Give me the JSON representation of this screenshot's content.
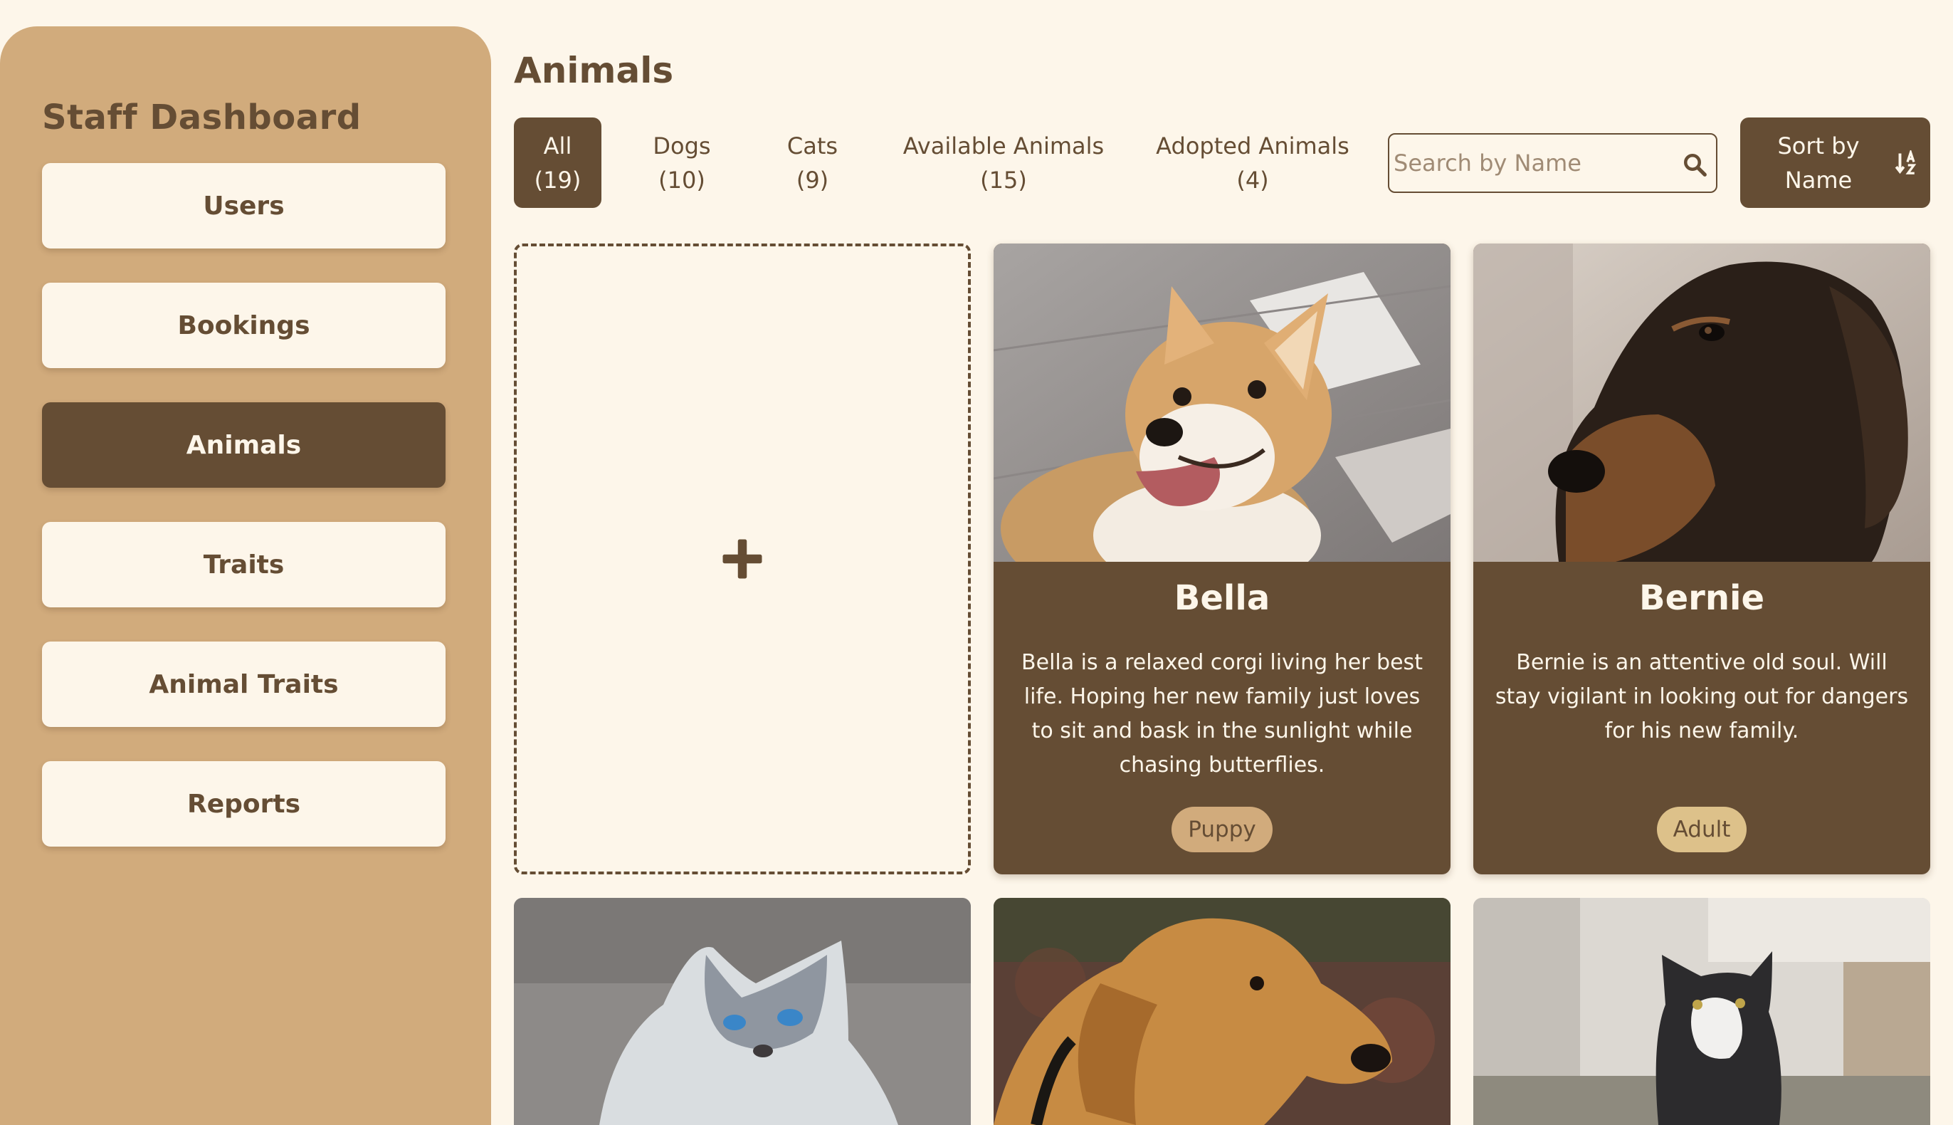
{
  "sidebar": {
    "title": "Staff Dashboard",
    "items": [
      {
        "label": "Users",
        "active": false
      },
      {
        "label": "Bookings",
        "active": false
      },
      {
        "label": "Animals",
        "active": true
      },
      {
        "label": "Traits",
        "active": false
      },
      {
        "label": "Animal Traits",
        "active": false
      },
      {
        "label": "Reports",
        "active": false
      }
    ]
  },
  "main": {
    "title": "Animals",
    "filters": [
      {
        "label": "All",
        "count": "(19)",
        "active": true
      },
      {
        "label": "Dogs",
        "count": "(10)",
        "active": false
      },
      {
        "label": "Cats",
        "count": "(9)",
        "active": false
      },
      {
        "label": "Available Animals",
        "count": "(15)",
        "active": false
      },
      {
        "label": "Adopted Animals",
        "count": "(4)",
        "active": false
      }
    ],
    "search": {
      "placeholder": "Search by Name",
      "value": "",
      "icon": "search-icon"
    },
    "sort": {
      "line1": "Sort by",
      "line2": "Name",
      "icon": "sort-alpha-down-icon"
    },
    "add_card": {
      "icon": "plus-icon"
    },
    "cards": [
      {
        "name": "Bella",
        "description": "Bella is a relaxed corgi living her best life. Hoping her new family just loves to sit and bask in the sunlight while chasing butterflies.",
        "badge": "Puppy"
      },
      {
        "name": "Bernie",
        "description": "Bernie is an attentive old soul. Will stay vigilant in looking out for dangers for his new family.",
        "badge": "Adult"
      }
    ]
  },
  "colors": {
    "background": "#fdf6ea",
    "sidebar": "#d1ab7c",
    "primary": "#654d34",
    "badge_puppy": "#d1ab7c",
    "badge_adult": "#ddc18a"
  }
}
